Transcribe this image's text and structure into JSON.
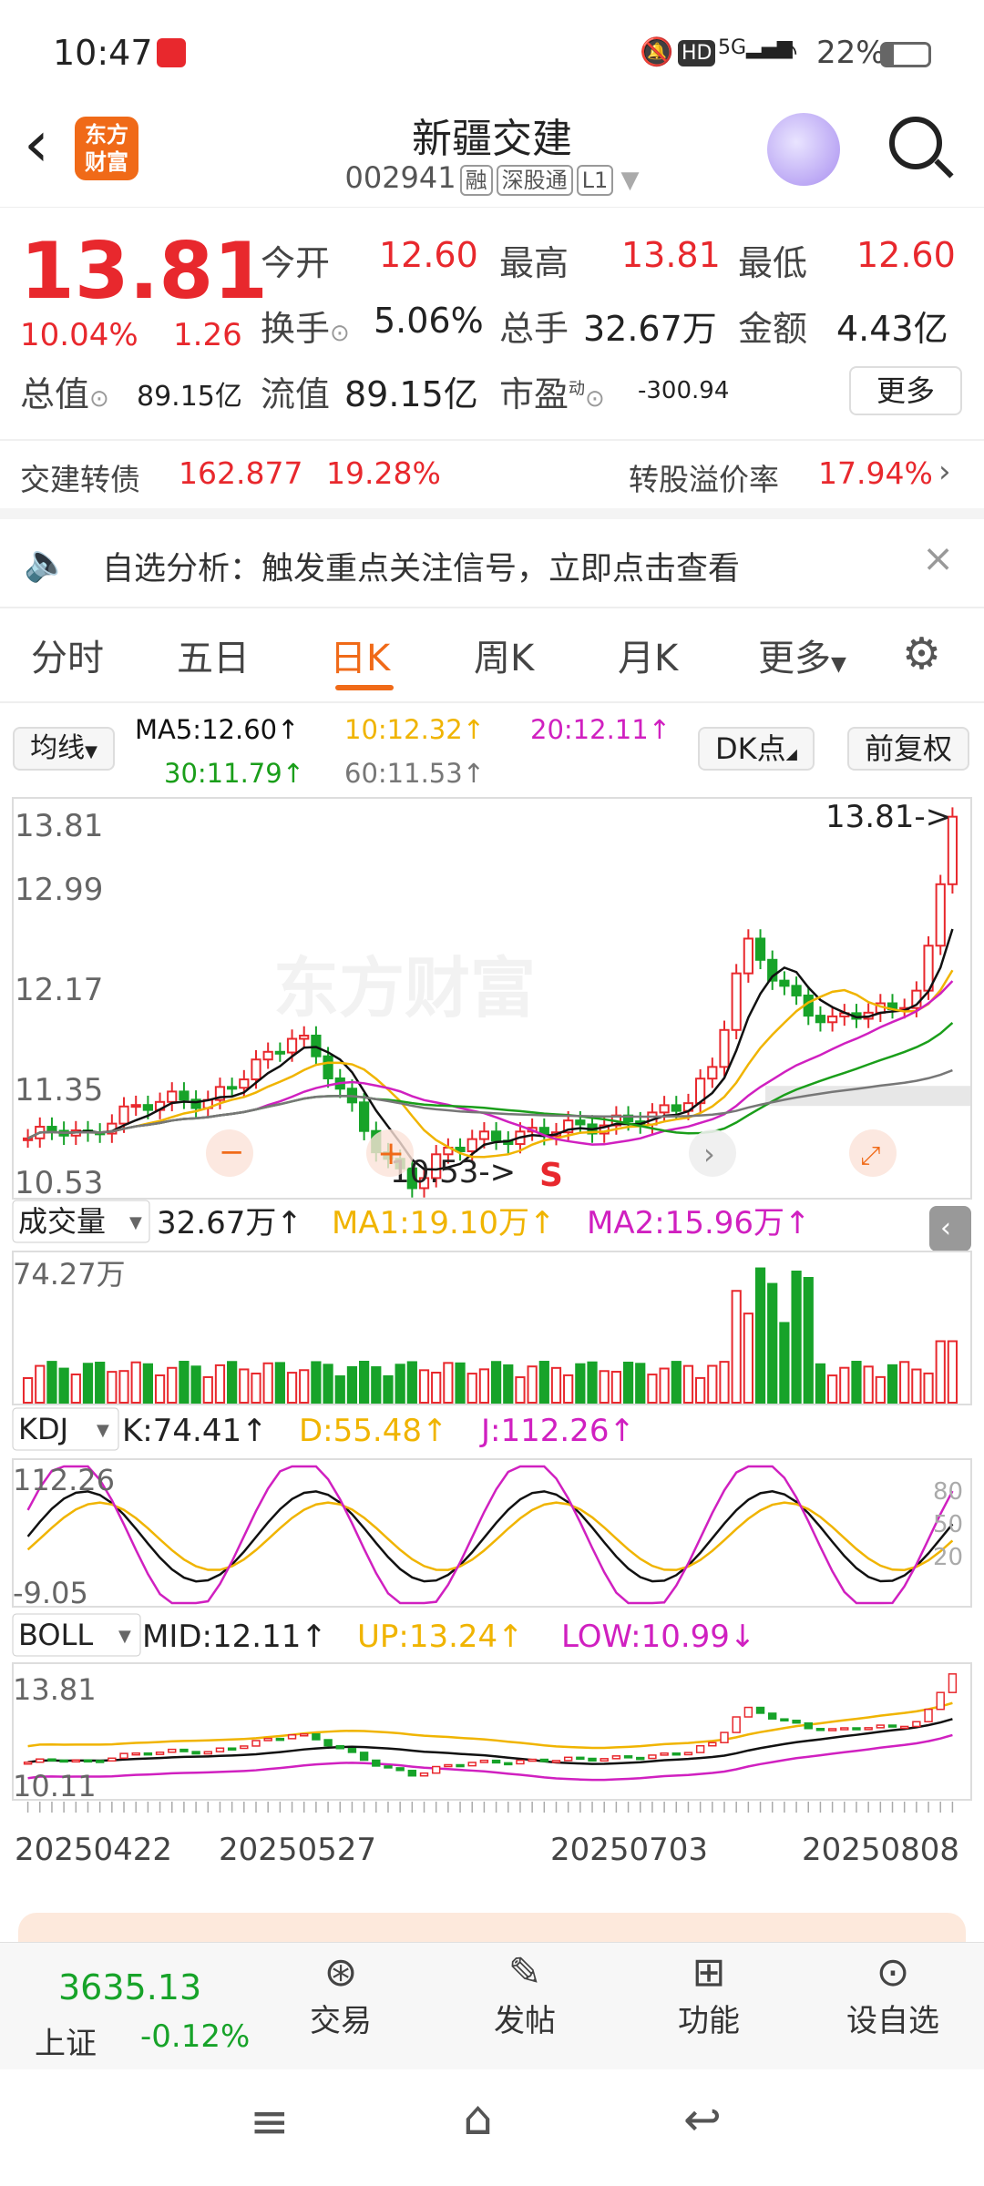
{
  "status": {
    "time": "10:47",
    "battery": "22%",
    "network": "5G"
  },
  "header": {
    "title": "新疆交建",
    "code": "002941",
    "tags": [
      "融",
      "深股通",
      "L1"
    ],
    "logo_line1": "东方",
    "logo_line2": "财富"
  },
  "quote": {
    "price": "13.81",
    "pct": "10.04%",
    "chg": "1.26",
    "open_l": "今开",
    "open": "12.60",
    "high_l": "最高",
    "high": "13.81",
    "low_l": "最低",
    "low": "12.60",
    "turn_l": "换手",
    "turn": "5.06%",
    "vol_l": "总手",
    "vol": "32.67万",
    "amt_l": "金额",
    "amt": "4.43亿",
    "mcap_l": "总值",
    "mcap": "89.15亿",
    "fcap_l": "流值",
    "fcap": "89.15亿",
    "pe_l": "市盈",
    "pe_sup": "动",
    "pe": "-300.94",
    "more": "更多"
  },
  "bond": {
    "name": "交建转债",
    "price": "162.877",
    "pct": "19.28%",
    "prem_l": "转股溢价率",
    "prem": "17.94%"
  },
  "notice": {
    "text": "自选分析：触发重点关注信号，立即点击查看"
  },
  "tabs": [
    "分时",
    "五日",
    "日K",
    "周K",
    "月K",
    "更多"
  ],
  "active_tab": "日K",
  "ma": {
    "btn": "均线",
    "ma5": "MA5:12.60↑",
    "ma10": "10:12.32↑",
    "ma20": "20:12.11↑",
    "ma30": "30:11.79↑",
    "ma60": "60:11.53↑",
    "dk": "DK点",
    "fq": "前复权"
  },
  "price_axis": [
    "13.81",
    "12.99",
    "12.17",
    "11.35",
    "10.53"
  ],
  "annot": {
    "high": "13.81->",
    "low": "10.53->",
    "s": "S",
    "watermark": "东方财富"
  },
  "volume": {
    "btn": "成交量",
    "val": "32.67万↑",
    "ma1": "MA1:19.10万↑",
    "ma2": "MA2:15.96万↑",
    "max": "74.27万"
  },
  "kdj": {
    "btn": "KDJ",
    "k": "K:74.41↑",
    "d": "D:55.48↑",
    "j": "J:112.26↑",
    "max": "112.26",
    "min": "-9.05",
    "l80": "80",
    "l50": "50",
    "l20": "20"
  },
  "boll": {
    "btn": "BOLL",
    "mid": "MID:12.11↑",
    "up": "UP:13.24↑",
    "low": "LOW:10.99↓",
    "max": "13.81",
    "min": "10.11"
  },
  "dates": [
    "20250422",
    "20250527",
    "20250703",
    "20250808"
  ],
  "colors": {
    "up": "#e8282d",
    "down": "#17a329",
    "ma5": "#111111",
    "ma10": "#f0b400",
    "ma20": "#d020c0",
    "ma30": "#1a9e1a",
    "ma60": "#777777"
  },
  "bottom": {
    "index_val": "3635.13",
    "index_name": "上证",
    "index_pct": "-0.12%",
    "items": [
      "交易",
      "发帖",
      "功能",
      "设自选"
    ]
  }
}
